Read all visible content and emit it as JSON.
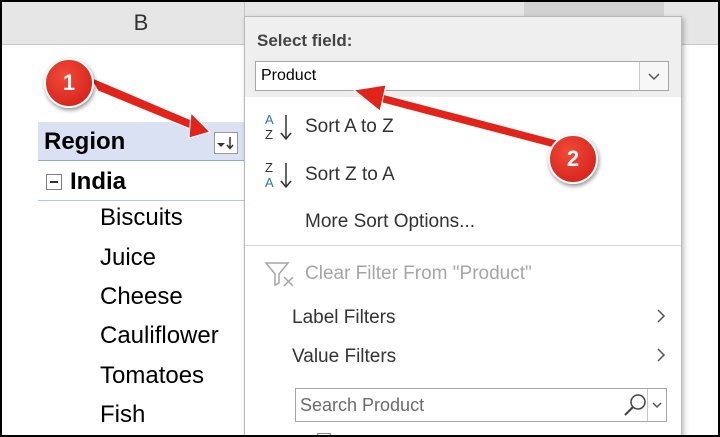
{
  "columns": {
    "b": "B"
  },
  "sheet": {
    "region_label": "Region",
    "group_label": "India",
    "items": [
      "Biscuits",
      "Juice",
      "Cheese",
      "Cauliflower",
      "Tomatoes",
      "Fish"
    ]
  },
  "panel": {
    "select_field_label": "Select field:",
    "selected_field": "Product",
    "sort_a_to_z": "Sort A to Z",
    "sort_z_to_a": "Sort Z to A",
    "more_sort_options": "More Sort Options...",
    "clear_filter": "Clear Filter From \"Product\"",
    "label_filters": "Label Filters",
    "value_filters": "Value Filters",
    "search_placeholder": "Search Product"
  },
  "annotations": {
    "badge1": "1",
    "badge2": "2"
  },
  "colors": {
    "annotation_red": "#e2231a",
    "header_fill": "#d9e1f2",
    "sort_icon_blue": "#2e75b6"
  }
}
